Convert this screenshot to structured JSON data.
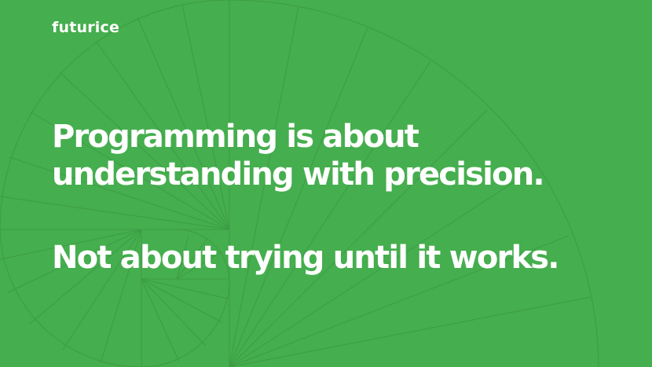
{
  "brand": {
    "logo_text": "futurice"
  },
  "quote": {
    "line1": "Programming is about",
    "line2": "understanding with precision.",
    "line3": "Not about trying until it works."
  },
  "colors": {
    "background": "#45ae4e",
    "pattern": "#3d9c45",
    "text": "#ffffff"
  }
}
